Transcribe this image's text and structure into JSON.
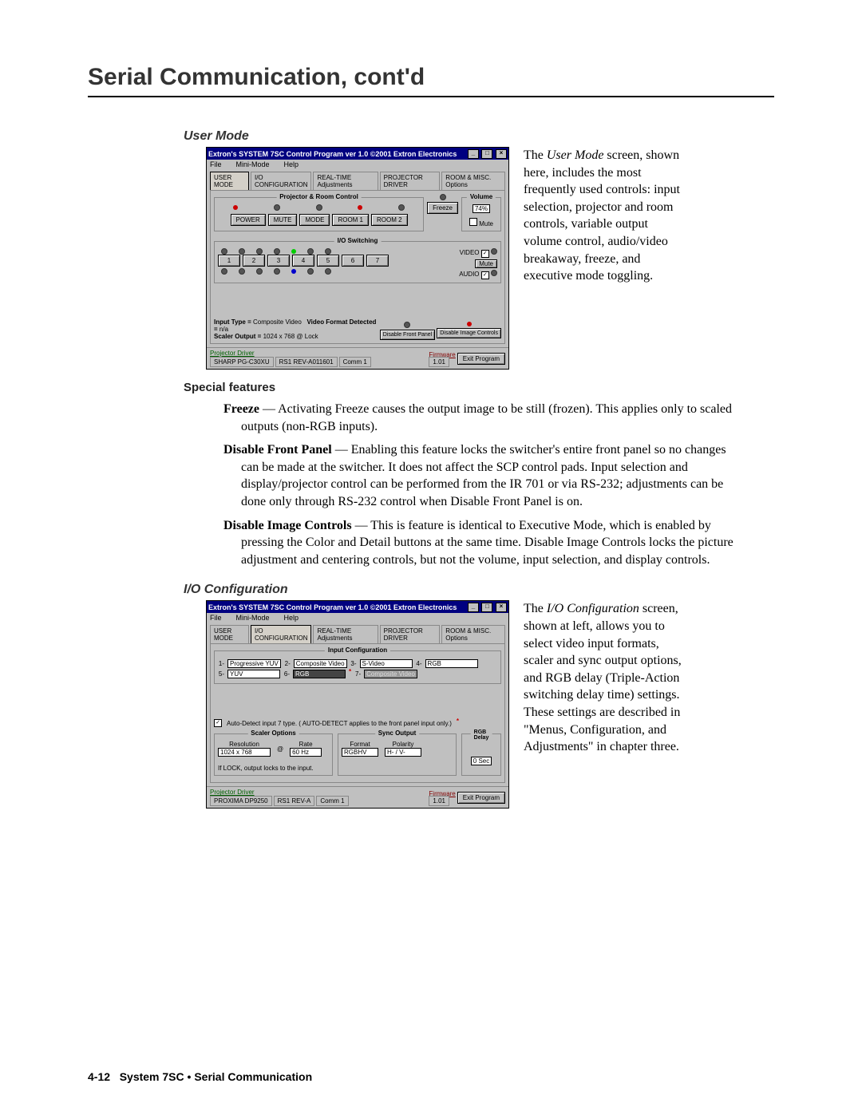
{
  "page": {
    "title": "Serial Communication, cont'd",
    "footer_page": "4-12",
    "footer_text": "System 7SC • Serial Communication"
  },
  "usermode": {
    "section_title": "User Mode",
    "side_text": "The User Mode screen, shown here, includes the most frequently used controls: input selection, projector and room controls, variable output volume control, audio/video breakaway, freeze, and executive mode toggling.",
    "special_title": "Special features",
    "freeze_label": "Freeze",
    "freeze_text": " — Activating Freeze causes the output image to be still (frozen).  This applies only to scaled outputs (non-RGB inputs).",
    "dfp_label": "Disable Front Panel",
    "dfp_text": " — Enabling this feature locks the switcher's entire front panel so no changes can be made at the switcher.  It does not affect the SCP control pads.  Input selection and display/projector control can be performed from the IR 701 or via RS-232; adjustments can be done only through RS-232 control when Disable Front Panel is on.",
    "dic_label": "Disable Image Controls",
    "dic_text": " — This is feature is identical to Executive Mode, which is enabled by pressing the Color and Detail buttons at the same time.  Disable Image Controls locks the picture adjustment and centering controls, but not the volume, input selection, and display controls."
  },
  "screenshot1": {
    "title": "Extron's SYSTEM 7SC Control Program    ver 1.0   ©2001 Extron Electronics",
    "menu_file": "File",
    "menu_mini": "Mini-Mode",
    "menu_help": "Help",
    "tab_user": "USER MODE",
    "tab_io": "I/O CONFIGURATION",
    "tab_rt": "REAL-TIME Adjustments",
    "tab_pd": "PROJECTOR DRIVER",
    "tab_rm": "ROOM & MISC. Options",
    "grp_proj": "Projector & Room Control",
    "btn_power": "POWER",
    "btn_mute": "MUTE",
    "btn_mode": "MODE",
    "btn_room1": "ROOM 1",
    "btn_room2": "ROOM 2",
    "btn_freeze": "Freeze",
    "vol_label": "Volume",
    "vol_value": "74%",
    "vol_mute": "Mute",
    "grp_io": "I/O Switching",
    "video_label": "VIDEO",
    "audio_label": "AUDIO",
    "mute_label": "Mute",
    "inputs": [
      "1",
      "2",
      "3",
      "4",
      "5",
      "6",
      "7"
    ],
    "input_type_label": "Input Type =",
    "input_type_val": "Composite Video",
    "vfd_label": "Video Format Detected =",
    "vfd_val": "n/a",
    "scaler_label": "Scaler Output =",
    "scaler_val": "1024 x 768 @ Lock",
    "btn_dfp": "Disable Front Panel",
    "btn_dic": "Disable Image Controls",
    "btn_exit": "Exit Program",
    "driver_head": "Projector Driver",
    "driver_val": "SHARP PG-C30XU",
    "driver_rev": "RS1 REV-A011601",
    "comm": "Comm 1",
    "fw_head": "Firmware",
    "fw_val": "1.01"
  },
  "ioconfig": {
    "section_title": "I/O Configuration",
    "side_text": "The I/O Configuration screen, shown at left, allows you to select video input formats, scaler and sync output options, and RGB delay (Triple-Action switching delay time) settings.  These settings are described in \"Menus, Configuration, and Adjustments\" in chapter three."
  },
  "screenshot2": {
    "grp_input": "Input Configuration",
    "in1": "Progressive YUV",
    "in2": "Composite Video",
    "in3": "S-Video",
    "in4": "RGB",
    "in5": "YUV",
    "in6": "RGB",
    "in7": "Composite Video",
    "auto_detect": "Auto-Detect input 7 type. ( AUTO-DETECT applies to the front panel input only.)",
    "grp_scaler": "Scaler Options",
    "res_label": "Resolution",
    "rate_label": "Rate",
    "res_val": "1024 x 768",
    "rate_val": "60 Hz",
    "lock_note": "If LOCK, output locks to the input.",
    "grp_sync": "Sync Output",
    "format_label": "Format",
    "polarity_label": "Polarity",
    "format_val": "RGBHV",
    "polarity_val": "H- / V-",
    "grp_rgb": "RGB Delay",
    "rgb_val": "0 Sec",
    "driver_val": "PROXIMA DP9250",
    "driver_rev": "RS1 REV-A"
  }
}
